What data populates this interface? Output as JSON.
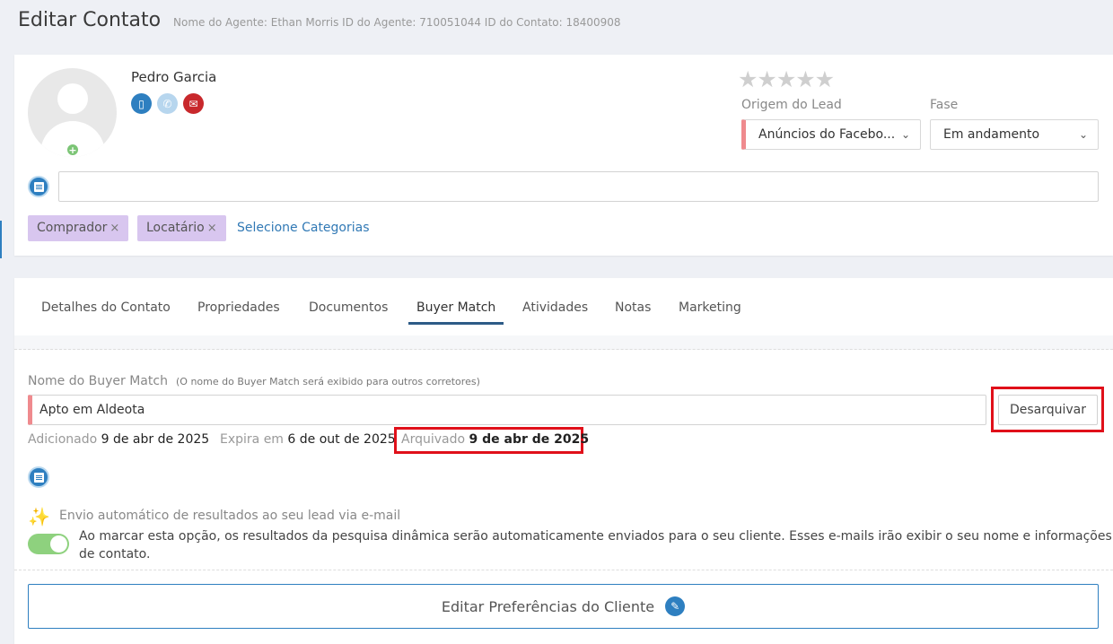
{
  "header": {
    "title": "Editar Contato",
    "meta": "Nome do Agente: Ethan Morris ID do Agente: 710051044 ID do Contato: 18400908"
  },
  "contact": {
    "name": "Pedro Garcia",
    "avatar_add": "+",
    "rating_stars": "★★★★★",
    "rating_value": 0,
    "origem_label": "Origem do Lead",
    "origem_value": "Anúncios do Facebo...",
    "fase_label": "Fase",
    "fase_value": "Em andamento",
    "note_value": "",
    "tags": [
      {
        "label": "Comprador",
        "remove": "×"
      },
      {
        "label": "Locatário",
        "remove": "×"
      }
    ],
    "select_categories": "Selecione Categorias"
  },
  "tabs": [
    {
      "label": "Detalhes do Contato"
    },
    {
      "label": "Propriedades"
    },
    {
      "label": "Documentos"
    },
    {
      "label": "Buyer Match"
    },
    {
      "label": "Atividades"
    },
    {
      "label": "Notas"
    },
    {
      "label": "Marketing"
    }
  ],
  "active_tab": "Buyer Match",
  "buyer_match": {
    "label": "Nome do Buyer Match",
    "note": "(O nome do Buyer Match será exibido para outros corretores)",
    "value": "Apto em Aldeota",
    "unarchive_button": "Desarquivar",
    "added_label": "Adicionado",
    "added_value": "9 de abr de 2025",
    "expires_label": "Expira em",
    "expires_value": "6 de out de 2025",
    "archived_label": "Arquivado",
    "archived_value": "9 de abr de 2025",
    "auto_send_label": "Envio automático de resultados ao seu lead via e-mail",
    "auto_send_description": "Ao marcar esta opção, os resultados da pesquisa dinâmica serão automaticamente enviados para o seu cliente. Esses e-mails irão exibir o seu nome e informações de contato.",
    "auto_send_enabled": true,
    "preferences_button": "Editar Preferências do Cliente"
  },
  "colors": {
    "accent": "#2e7fc0",
    "tag_bg": "#d8c6ef",
    "highlight": "#e0101a",
    "toggle_on": "#8ed17e",
    "required_marker": "#ef8a8e"
  },
  "icons": {
    "mobile": "▯",
    "call": "✆",
    "email": "✉",
    "sparkle": "✨",
    "pencil": "✎",
    "chevron": "⌄"
  }
}
